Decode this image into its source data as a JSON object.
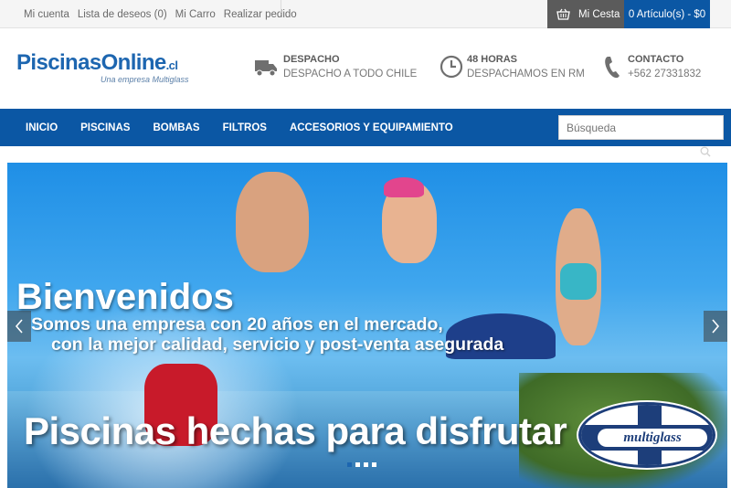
{
  "topbar": {
    "links": [
      "Mi cuenta",
      "Lista de deseos (0)",
      "Mi Carro",
      "Realizar pedido"
    ],
    "cart_label": "Mi Cesta",
    "cart_summary": "0 Artículo(s) - $0"
  },
  "header": {
    "logo_main": "PiscinasOnline",
    "logo_suffix": ".cl",
    "logo_sub": "Una empresa Multiglass",
    "info": [
      {
        "title": "DESPACHO",
        "subtitle": "DESPACHO A TODO CHILE",
        "icon": "truck-icon"
      },
      {
        "title": "48 HORAS",
        "subtitle": "DESPACHAMOS EN RM",
        "icon": "clock-icon"
      },
      {
        "title": "CONTACTO",
        "subtitle": "+562 27331832",
        "icon": "phone-icon"
      }
    ]
  },
  "nav": {
    "items": [
      "INICIO",
      "PISCINAS",
      "BOMBAS",
      "FILTROS",
      "ACCESORIOS Y EQUIPAMIENTO"
    ],
    "search_placeholder": "Búsqueda"
  },
  "hero": {
    "welcome": "Bienvenidos",
    "line1": "Somos una empresa con 20 años en el mercado,",
    "line2": "con la mejor calidad, servicio y post-venta asegurada",
    "headline": "Piscinas hechas para disfrutar",
    "badge_text": "multiglass"
  },
  "colors": {
    "primary_blue": "#0b57a4",
    "cart_gray": "#5b5b5b",
    "logo_blue": "#1d66b0"
  }
}
